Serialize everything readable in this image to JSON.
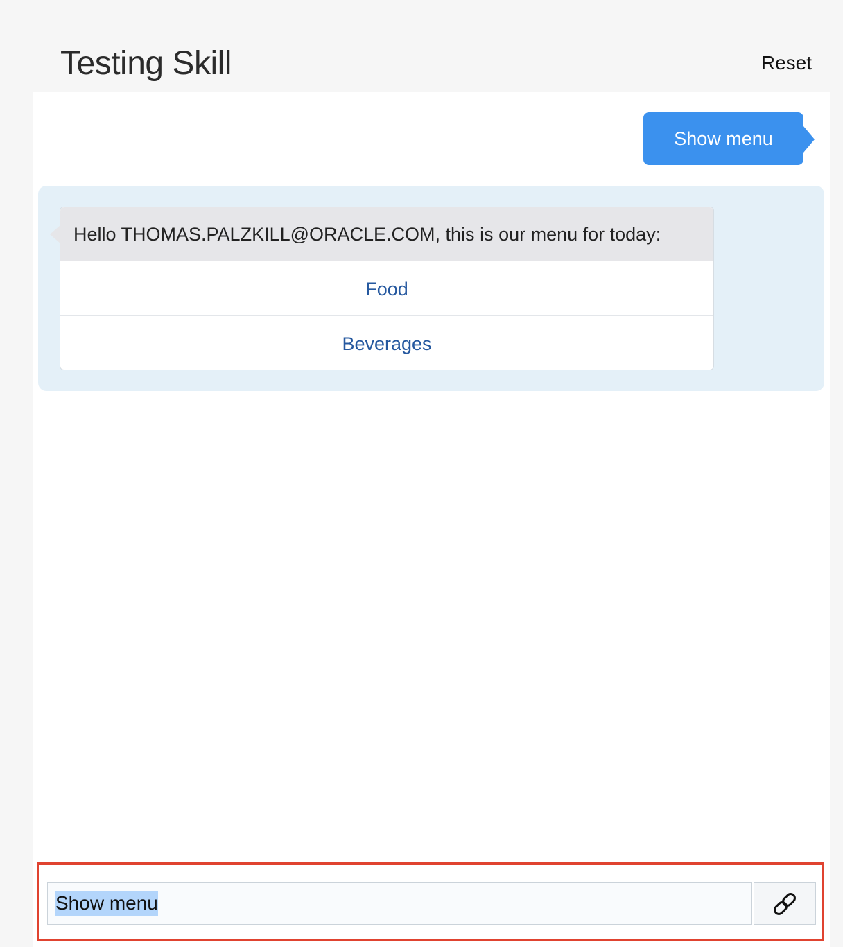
{
  "header": {
    "title": "Testing Skill",
    "reset_label": "Reset"
  },
  "conversation": {
    "user_message": "Show menu",
    "bot_message": "Hello THOMAS.PALZKILL@ORACLE.COM, this is our menu for today:",
    "options": [
      {
        "label": "Food"
      },
      {
        "label": "Beverages"
      }
    ]
  },
  "composer": {
    "value": "Show menu",
    "value_selected": true,
    "attach_icon": "link-icon"
  },
  "colors": {
    "user_bubble": "#3b91ee",
    "bot_area": "#e4f0f8",
    "option_link": "#25589f",
    "highlight_border": "#e04330",
    "text_selection": "#b3d5fb"
  }
}
